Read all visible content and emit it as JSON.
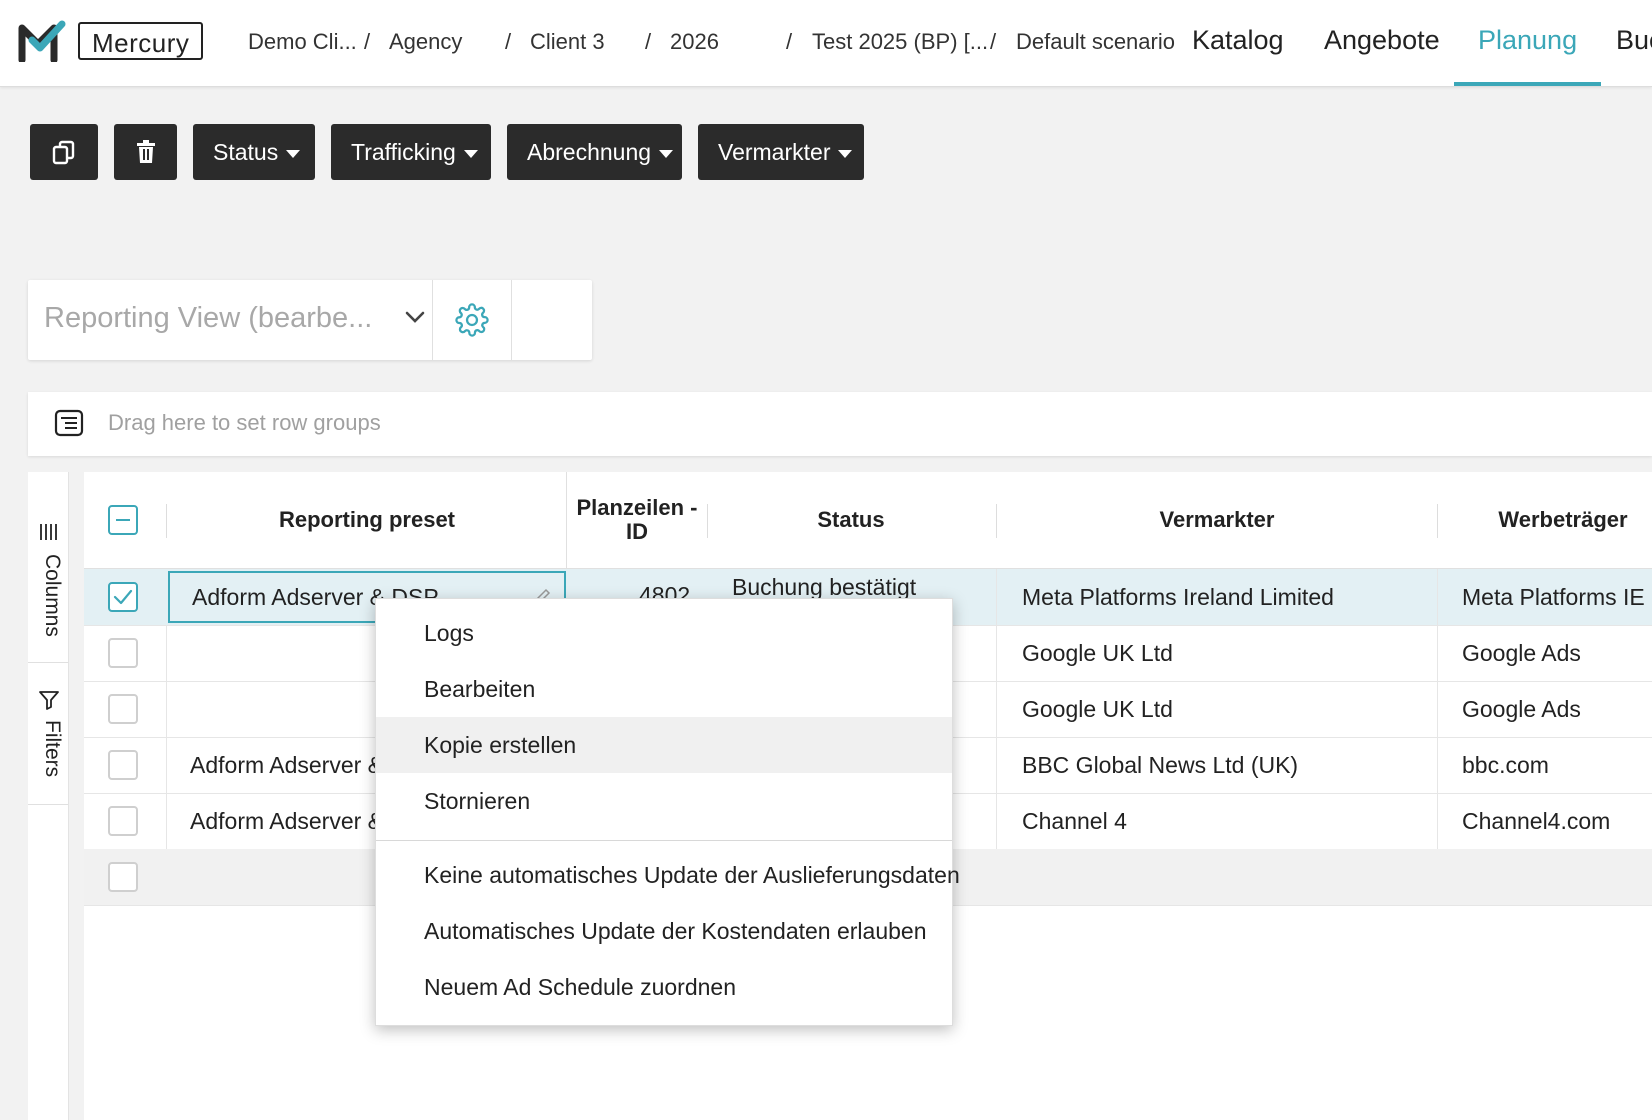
{
  "app": {
    "name": "Mercury"
  },
  "breadcrumb": [
    "Demo Cli...",
    "Agency",
    "Client 3",
    "2026",
    "Test 2025 (BP) [...",
    "Default scenario"
  ],
  "nav": {
    "tabs": [
      {
        "label": "Katalog",
        "active": false
      },
      {
        "label": "Angebote",
        "active": false
      },
      {
        "label": "Planung",
        "active": true
      },
      {
        "label": "Buc",
        "active": false
      }
    ]
  },
  "toolbar": {
    "copy_icon": "copy-icon",
    "delete_icon": "trash-icon",
    "status": "Status",
    "trafficking": "Trafficking",
    "abrechnung": "Abrechnung",
    "vermarkter": "Vermarkter"
  },
  "view": {
    "selected": "Reporting View (bearbe...",
    "settings_icon": "gear-icon"
  },
  "rowgroup": {
    "placeholder": "Drag here to set row groups"
  },
  "side": {
    "columns": "Columns",
    "filters": "Filters"
  },
  "grid": {
    "headers": {
      "preset": "Reporting preset",
      "planzeilen": "Planzeilen -ID",
      "status": "Status",
      "vermarkter": "Vermarkter",
      "werbetraeger": "Werbeträger"
    },
    "rows": [
      {
        "preset": "Adform Adserver & DSP",
        "id": "4802",
        "status": "Buchung bestätigt",
        "vermarkter": "Meta Platforms Ireland Limited",
        "werbetraeger": "Meta Platforms IE ...",
        "selected": true
      },
      {
        "preset": "",
        "id": "",
        "status": "",
        "vermarkter": "Google UK Ltd",
        "werbetraeger": "Google Ads",
        "selected": false
      },
      {
        "preset": "",
        "id": "",
        "status": "",
        "vermarkter": "Google UK Ltd",
        "werbetraeger": "Google Ads",
        "selected": false
      },
      {
        "preset": "Adform Adserver &",
        "id": "",
        "status": "",
        "vermarkter": "BBC Global News Ltd (UK)",
        "werbetraeger": "bbc.com",
        "selected": false
      },
      {
        "preset": "Adform Adserver &",
        "id": "",
        "status": "",
        "vermarkter": "Channel 4",
        "werbetraeger": "Channel4.com",
        "selected": false
      }
    ]
  },
  "context_menu": {
    "items": [
      "Logs",
      "Bearbeiten",
      "Kopie erstellen",
      "Stornieren",
      "Keine automatisches Update der Auslieferungsdaten",
      "Automatisches Update der Kostendaten erlauben",
      "Neuem Ad Schedule zuordnen"
    ],
    "highlighted": "Kopie erstellen"
  },
  "colors": {
    "accent": "#3ba7b8",
    "dark_button": "#2b2b2b",
    "selected_row": "#e3f0f4"
  }
}
